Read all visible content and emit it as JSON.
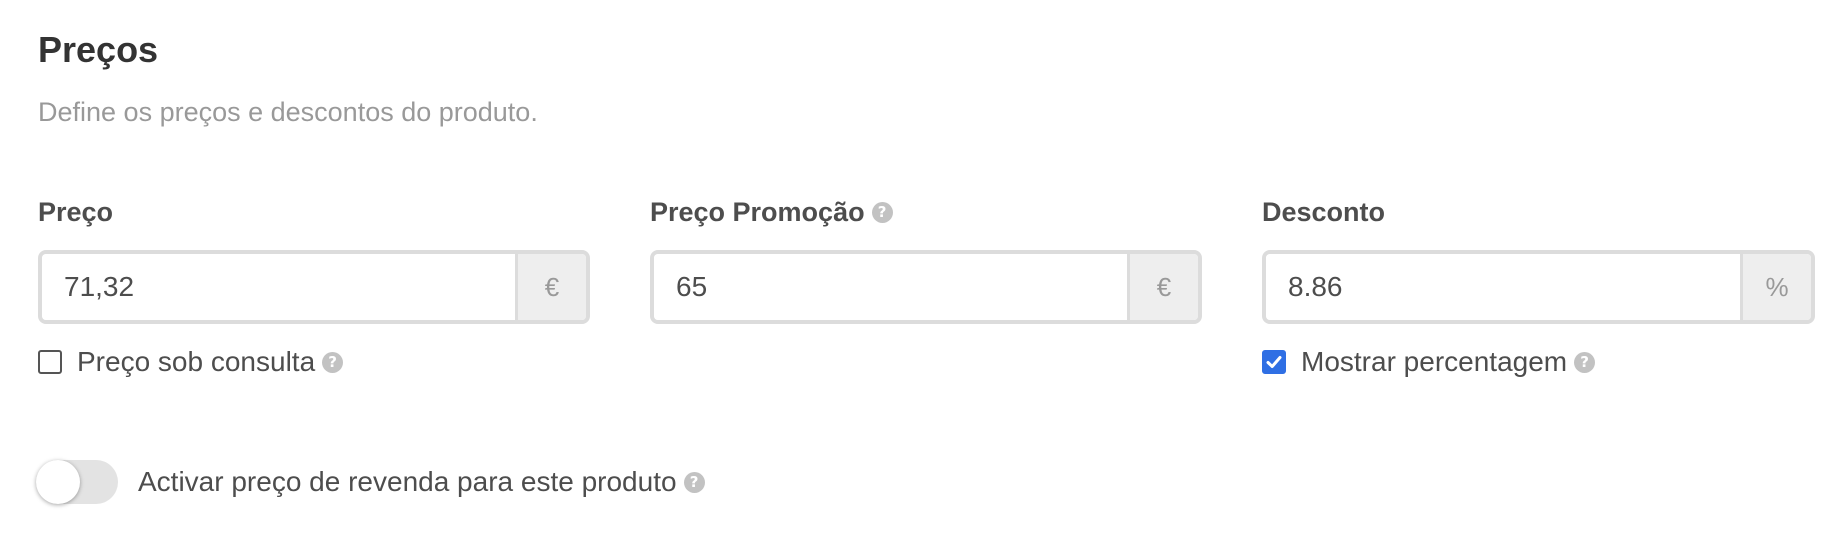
{
  "section": {
    "title": "Preços",
    "subtitle": "Define os preços e descontos do produto."
  },
  "fields": {
    "price": {
      "label": "Preço",
      "value": "71,32",
      "addon": "€"
    },
    "promo_price": {
      "label": "Preço Promoção",
      "value": "65",
      "addon": "€",
      "help_icon": "?"
    },
    "discount": {
      "label": "Desconto",
      "value": "8.86",
      "addon": "%"
    }
  },
  "checkboxes": {
    "price_on_request": {
      "label": "Preço sob consulta",
      "checked": false,
      "help_icon": "?"
    },
    "show_percentage": {
      "label": "Mostrar percentagem",
      "checked": true,
      "help_icon": "?"
    }
  },
  "toggle": {
    "label": "Activar preço de revenda para este produto",
    "enabled": false,
    "help_icon": "?"
  },
  "colors": {
    "accent": "#2f6fe4",
    "border": "#dcdcdc",
    "muted_text": "#999999"
  }
}
